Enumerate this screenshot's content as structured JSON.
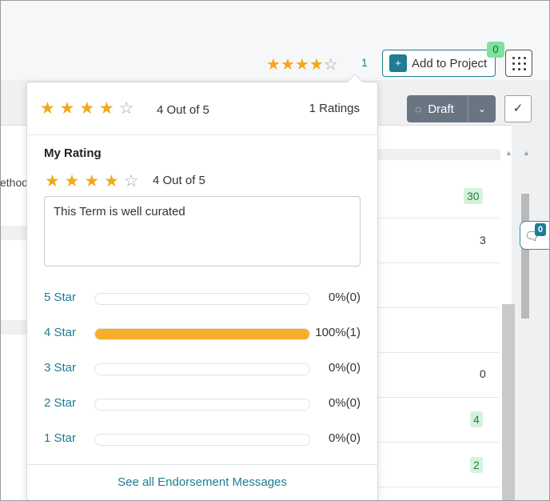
{
  "header": {
    "rating_stars": [
      "filled",
      "filled",
      "filled",
      "filled",
      "empty"
    ],
    "rating_count": "1",
    "add_to_project_label": "Add to Project",
    "project_count": "0",
    "status_label": "Draft"
  },
  "background": {
    "left_cut_text": "ethod",
    "column_values": [
      "30",
      "3",
      "0",
      "4",
      "2"
    ],
    "comment_count": "0"
  },
  "popover": {
    "overall_stars": [
      "filled",
      "filled",
      "filled",
      "filled",
      "empty"
    ],
    "overall_value": "4 Out of 5",
    "total_ratings": "1 Ratings",
    "my_rating_title": "My Rating",
    "my_stars": [
      "filled",
      "filled",
      "filled",
      "filled",
      "empty"
    ],
    "my_value": "4 Out of 5",
    "my_comment": "This Term is well curated",
    "distribution": [
      {
        "label": "5 Star",
        "fraction": 0,
        "text": "0%(0)"
      },
      {
        "label": "4 Star",
        "fraction": 1,
        "text": "100%(1)"
      },
      {
        "label": "3 Star",
        "fraction": 0,
        "text": "0%(0)"
      },
      {
        "label": "2 Star",
        "fraction": 0,
        "text": "0%(0)"
      },
      {
        "label": "1 Star",
        "fraction": 0,
        "text": "0%(0)"
      }
    ],
    "see_all_label": "See all Endorsement Messages"
  },
  "colors": {
    "accent": "#1e7c94",
    "star": "#f2a81c",
    "bar_fill": "#f7ae2a",
    "status_button": "#6a7582",
    "badge_green": "#7be39a"
  }
}
